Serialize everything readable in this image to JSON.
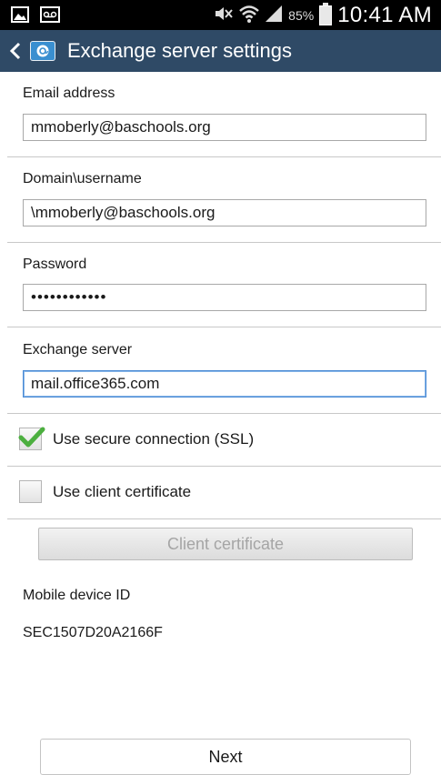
{
  "status_bar": {
    "battery_percent": "85%",
    "time": "10:41 AM",
    "icons": [
      "image-icon",
      "voicemail-icon",
      "mute-icon",
      "wifi-icon",
      "signal-icon",
      "battery-icon"
    ]
  },
  "action_bar": {
    "title": "Exchange server settings",
    "back_icon": "chevron-left-icon",
    "app_icon": "email-app-icon"
  },
  "form": {
    "email": {
      "label": "Email address",
      "value": "mmoberly@baschools.org"
    },
    "domain_username": {
      "label": "Domain\\username",
      "value": "\\mmoberly@baschools.org"
    },
    "password": {
      "label": "Password",
      "value": "••••••••••••"
    },
    "exchange_server": {
      "label": "Exchange server",
      "value": "mail.office365.com"
    }
  },
  "options": {
    "secure_connection": {
      "label": "Use secure connection (SSL)",
      "checked": true
    },
    "client_certificate": {
      "label": "Use client certificate",
      "checked": false
    }
  },
  "client_certificate_button": "Client certificate",
  "device": {
    "label": "Mobile device ID",
    "id": "SEC1507D20A2166F"
  },
  "next_button": "Next",
  "colors": {
    "action_bar": "#2f4a66",
    "check": "#4caf3f",
    "focus_border": "#4a8ad4"
  }
}
